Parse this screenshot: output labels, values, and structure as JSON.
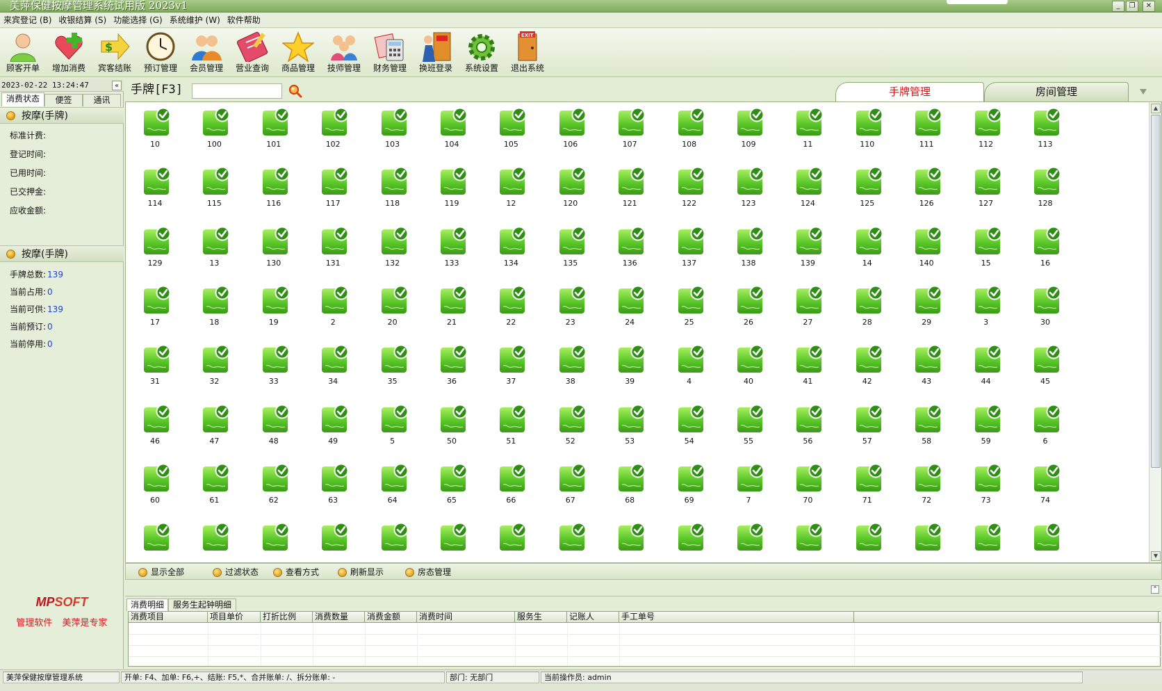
{
  "window": {
    "title": "美萍保健按摩管理系统试用版 2023v1",
    "controls": [
      "_",
      "❐",
      "✕"
    ]
  },
  "menu": [
    "来宾登记 (B)",
    "收银结算 (S)",
    "功能选择 (G)",
    "系统维护 (W)",
    "软件帮助"
  ],
  "toolbar": [
    {
      "label": "顾客开单",
      "icon": "customer-icon"
    },
    {
      "label": "增加消费",
      "icon": "add-consumption-icon"
    },
    {
      "label": "宾客结账",
      "icon": "checkout-icon"
    },
    {
      "label": "预订管理",
      "icon": "clock-icon"
    },
    {
      "label": "会员管理",
      "icon": "members-icon"
    },
    {
      "label": "营业查询",
      "icon": "query-icon"
    },
    {
      "label": "商品管理",
      "icon": "star-icon"
    },
    {
      "label": "技师管理",
      "icon": "technicians-icon"
    },
    {
      "label": "财务管理",
      "icon": "finance-icon"
    },
    {
      "label": "换班登录",
      "icon": "shift-login-icon"
    },
    {
      "label": "系统设置",
      "icon": "gear-icon"
    },
    {
      "label": "退出系统",
      "icon": "exit-door-icon"
    }
  ],
  "left": {
    "datetime": "2023-02-22 13:24:47",
    "collapse": "«",
    "tabs": [
      "消费状态",
      "便签",
      "通讯"
    ],
    "section1": {
      "title": "按摩(手牌)",
      "fields": [
        {
          "label": "标准计费:",
          "value": ""
        },
        {
          "label": "登记时间:",
          "value": ""
        },
        {
          "label": "已用时间:",
          "value": ""
        },
        {
          "label": "已交押金:",
          "value": ""
        },
        {
          "label": "应收金额:",
          "value": ""
        }
      ]
    },
    "section2": {
      "title": "按摩(手牌)",
      "fields": [
        {
          "label": "手牌总数:",
          "value": "139"
        },
        {
          "label": "当前占用:",
          "value": "0"
        },
        {
          "label": "当前可供:",
          "value": "139"
        },
        {
          "label": "当前预订:",
          "value": "0"
        },
        {
          "label": "当前停用:",
          "value": "0"
        }
      ]
    },
    "brand": {
      "logo_a": "MP",
      "logo_b": "SOFT",
      "slogan": "管理软件 美萍是专家"
    }
  },
  "main": {
    "search_label": "手牌[F3]",
    "search_value": "",
    "tabs": [
      "手牌管理",
      "房间管理"
    ],
    "wristbands": [
      "10",
      "100",
      "101",
      "102",
      "103",
      "104",
      "105",
      "106",
      "107",
      "108",
      "109",
      "11",
      "110",
      "111",
      "112",
      "113",
      "114",
      "115",
      "116",
      "117",
      "118",
      "119",
      "12",
      "120",
      "121",
      "122",
      "123",
      "124",
      "125",
      "126",
      "127",
      "128",
      "129",
      "13",
      "130",
      "131",
      "132",
      "133",
      "134",
      "135",
      "136",
      "137",
      "138",
      "139",
      "14",
      "140",
      "15",
      "16",
      "17",
      "18",
      "19",
      "2",
      "20",
      "21",
      "22",
      "23",
      "24",
      "25",
      "26",
      "27",
      "28",
      "29",
      "3",
      "30",
      "31",
      "32",
      "33",
      "34",
      "35",
      "36",
      "37",
      "38",
      "39",
      "4",
      "40",
      "41",
      "42",
      "43",
      "44",
      "45",
      "46",
      "47",
      "48",
      "49",
      "5",
      "50",
      "51",
      "52",
      "53",
      "54",
      "55",
      "56",
      "57",
      "58",
      "59",
      "6",
      "60",
      "61",
      "62",
      "63",
      "64",
      "65",
      "66",
      "67",
      "68",
      "69",
      "7",
      "70",
      "71",
      "72",
      "73",
      "74"
    ],
    "wristband_status": "available",
    "actions": [
      "显示全部",
      "过滤状态",
      "查看方式",
      "刷新显示",
      "房态管理"
    ],
    "detail_tabs": [
      "消费明细",
      "服务生起钟明细"
    ],
    "detail_columns": [
      "消费项目",
      "项目单价",
      "打折比例",
      "消费数量",
      "消费金额",
      "消费时间",
      "服务生",
      "记账人",
      "手工单号",
      ""
    ]
  },
  "statusbar": {
    "app": "美萍保健按摩管理系统",
    "hotkeys": "开单: F4、加单: F6,+、结账: F5,*、合并账单: /、拆分账单: -",
    "dept": "部门: 无部门",
    "operator": "当前操作员: admin"
  },
  "colors": {
    "accent_red": "#e01010",
    "value_blue": "#1a3fe0",
    "tag_green": "#4caf1f"
  }
}
